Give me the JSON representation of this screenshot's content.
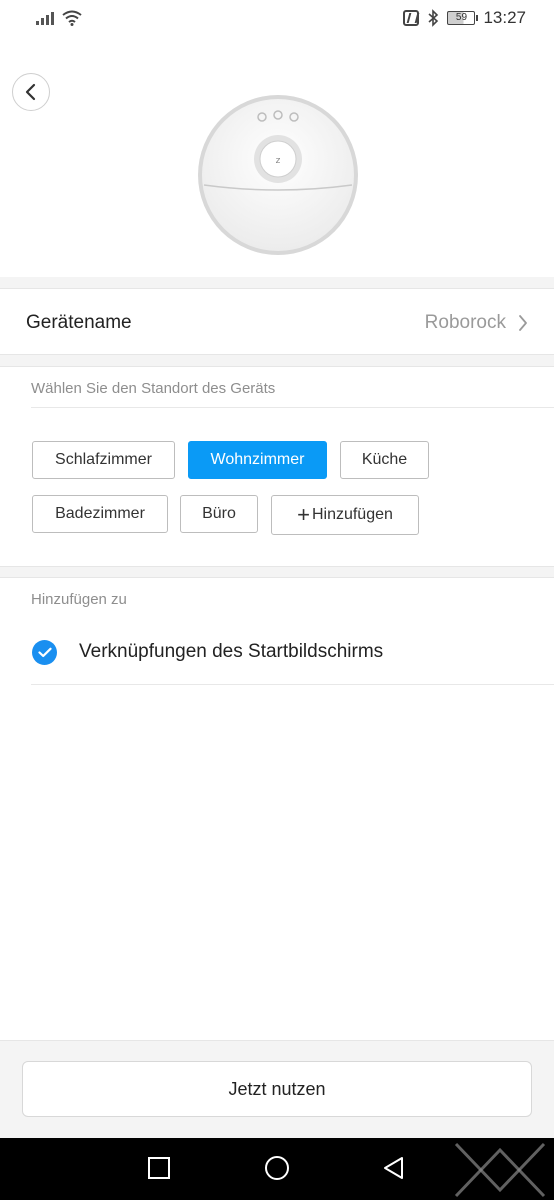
{
  "status_bar": {
    "time": "13:27",
    "battery": "59",
    "icons": [
      "signal-icon",
      "wifi-icon",
      "nfc-icon",
      "bluetooth-icon",
      "battery-icon"
    ]
  },
  "header": {
    "back_icon": "chevron-left-icon",
    "device_image": "robot-vacuum-image"
  },
  "device_name": {
    "label": "Gerätename",
    "value": "Roborock",
    "icon": "chevron-right-icon"
  },
  "location": {
    "caption": "Wählen Sie den Standort des Geräts",
    "rooms": [
      {
        "label": "Schlafzimmer",
        "selected": false
      },
      {
        "label": "Wohnzimmer",
        "selected": true
      },
      {
        "label": "Küche",
        "selected": false
      },
      {
        "label": "Badezimmer",
        "selected": false
      },
      {
        "label": "Büro",
        "selected": false
      }
    ],
    "add_label": "Hinzufügen"
  },
  "add_to": {
    "caption": "Hinzufügen zu",
    "option_label": "Verknüpfungen des Startbildschirms",
    "checked": true
  },
  "footer": {
    "button_label": "Jetzt nutzen"
  },
  "nav_bar": {
    "icons": [
      "recents-square-icon",
      "home-circle-icon",
      "back-triangle-icon"
    ]
  },
  "colors": {
    "accent": "#0a9af6",
    "check": "#1a8ff0",
    "background": "#f4f4f4"
  }
}
